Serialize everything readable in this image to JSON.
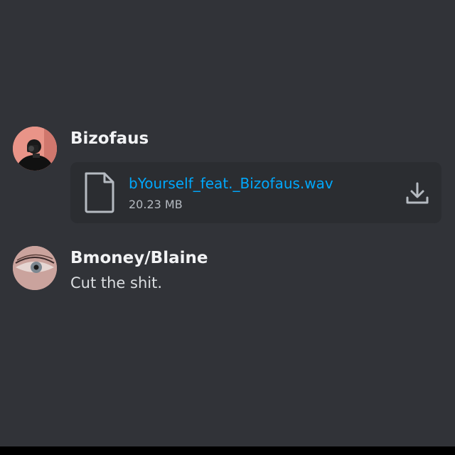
{
  "messages": [
    {
      "author": "Bizofaus",
      "avatar_icon": "avatar-photo",
      "attachment": {
        "file_name": "bYourself_feat._Bizofaus.wav",
        "file_size": "20.23 MB",
        "file_icon": "file-icon",
        "download_icon": "download-icon"
      }
    },
    {
      "author": "Bmoney/Blaine",
      "avatar_icon": "avatar-photo",
      "text": "Cut the shit."
    }
  ],
  "colors": {
    "background": "#313338",
    "attachment_bg": "#2b2d31",
    "username": "#f2f3f5",
    "message_text": "#dbdee1",
    "link": "#00a8fc",
    "muted": "#b5bac1"
  }
}
